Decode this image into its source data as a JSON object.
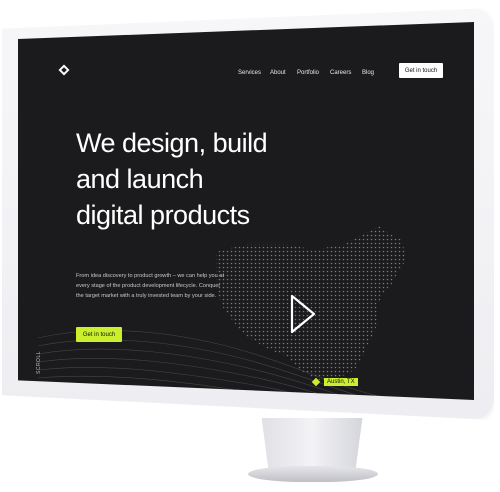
{
  "nav": {
    "items": [
      "Services",
      "About",
      "Portfolio",
      "Careers",
      "Blog"
    ],
    "cta_label": "Get in touch"
  },
  "hero": {
    "headline_lines": [
      "We design, build",
      "and launch",
      "digital products"
    ],
    "subtext": "From idea discovery to product growth – we can help you at every stage of the product development lifecycle. Conquer the target market with a truly invested team by your side.",
    "cta_label": "Get in touch",
    "scroll_label": "SCROLL",
    "location_label": "Austin, TX"
  },
  "colors": {
    "screen_bg": "#1b1b1d",
    "accent": "#c9ef2d",
    "text": "#ffffff"
  },
  "icons": [
    "logo-icon",
    "play-icon",
    "location-pin-icon"
  ]
}
